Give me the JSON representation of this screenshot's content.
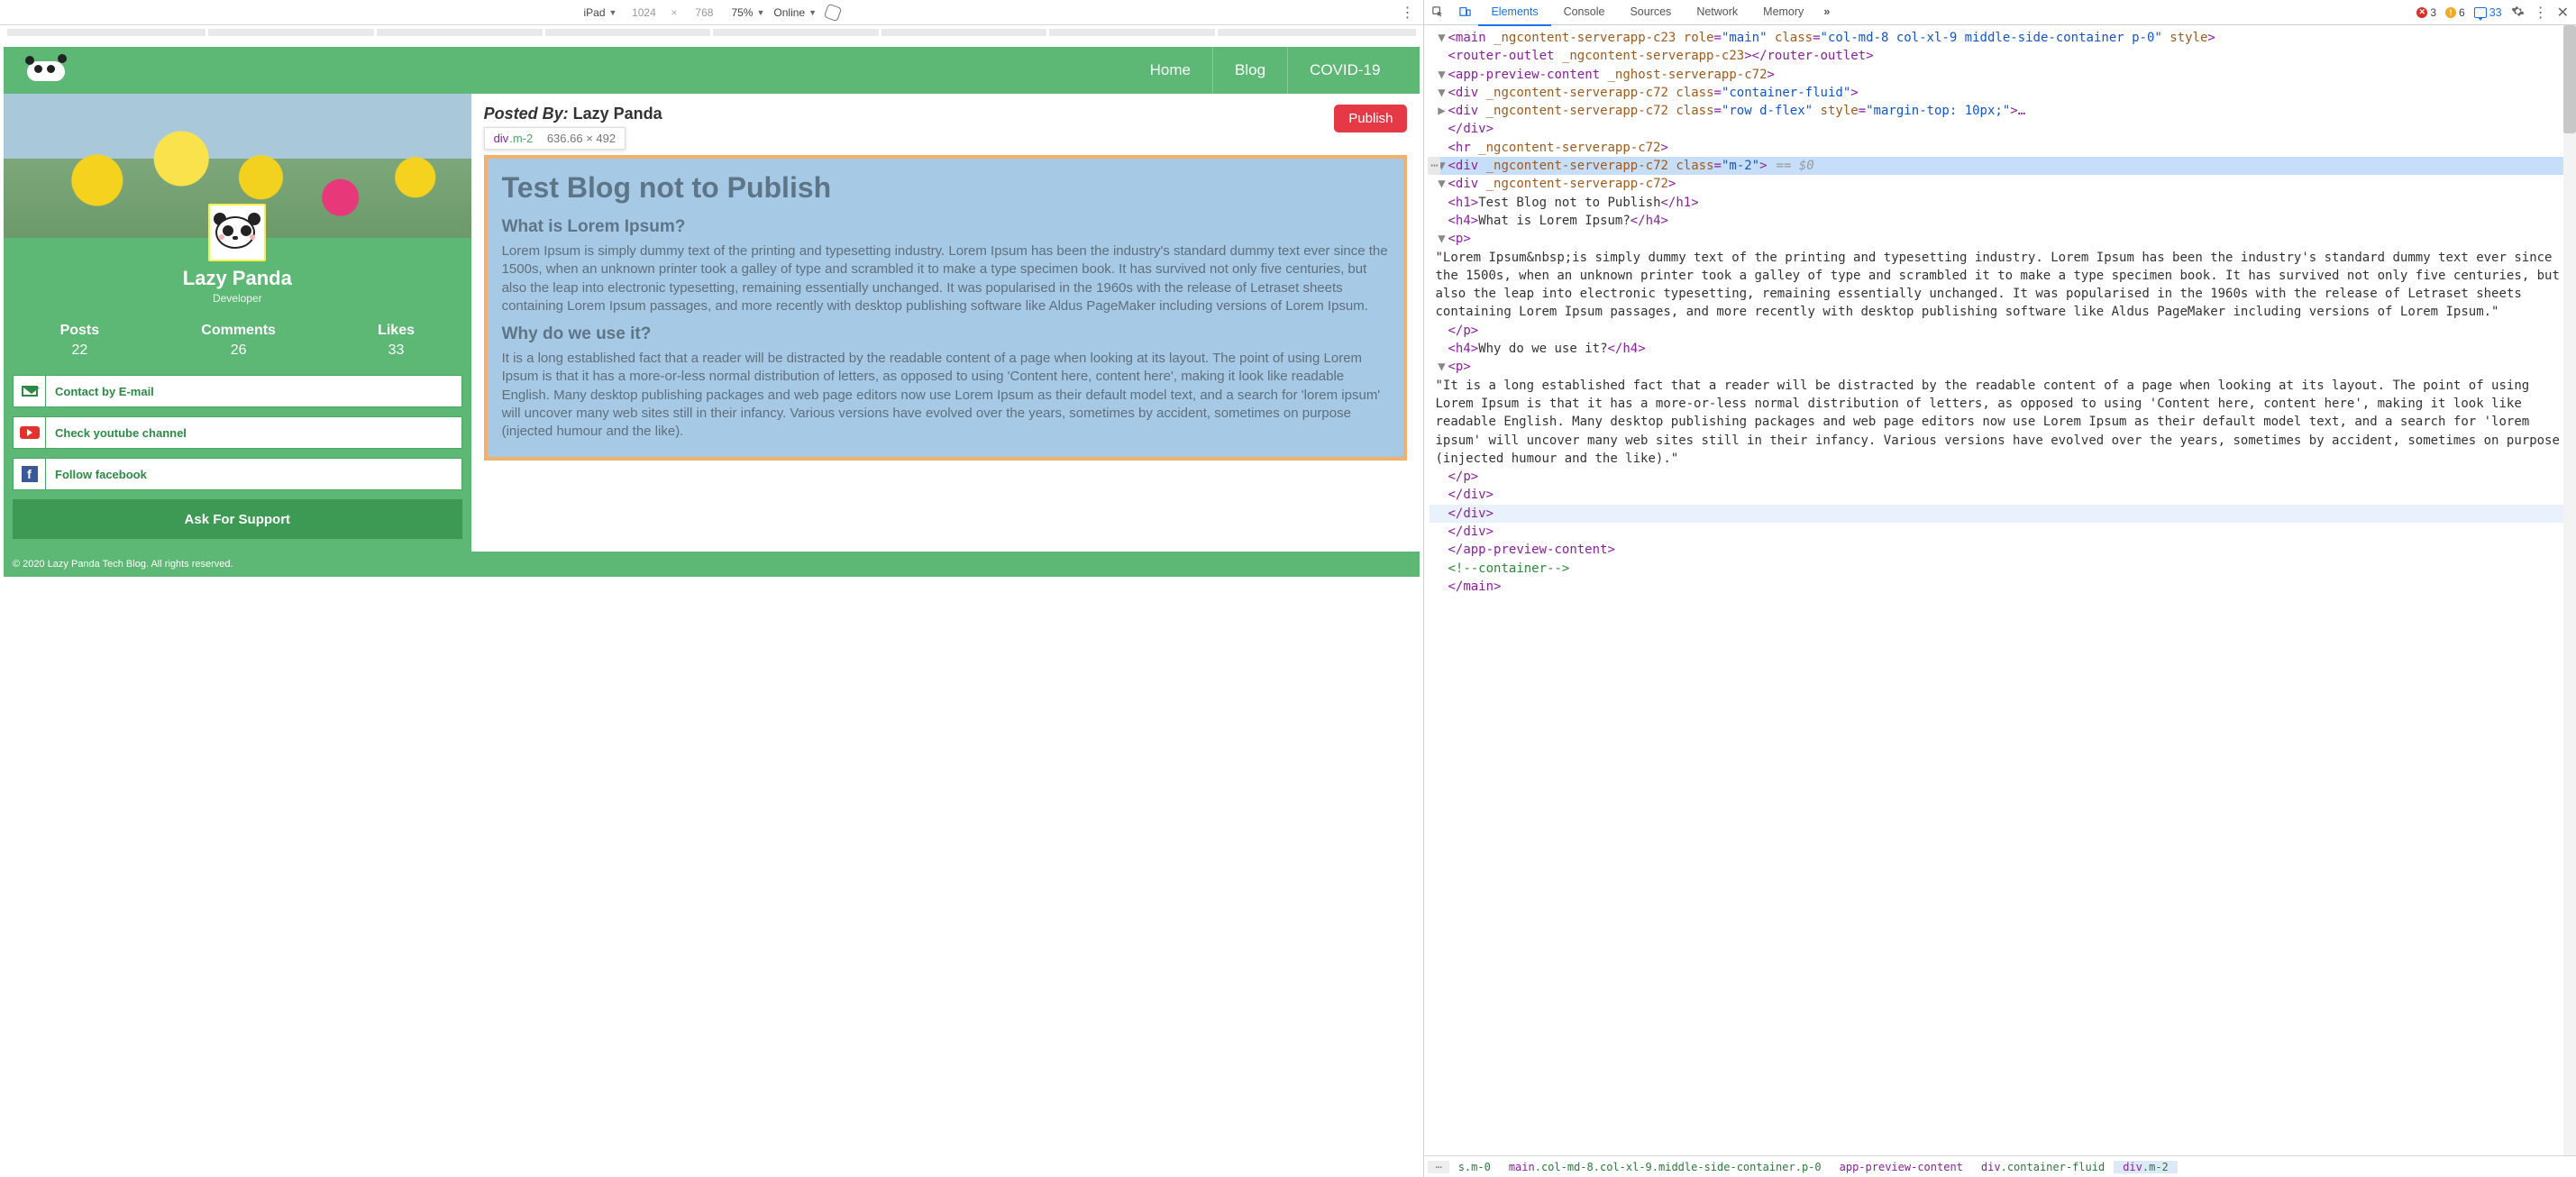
{
  "deviceToolbar": {
    "device": "iPad",
    "width": "1024",
    "height": "768",
    "zoom": "75%",
    "throttle": "Online"
  },
  "site": {
    "nav": {
      "home": "Home",
      "blog": "Blog",
      "covid": "COVID-19"
    },
    "profile": {
      "name": "Lazy Panda",
      "role": "Developer"
    },
    "stats": {
      "posts_lbl": "Posts",
      "posts": "22",
      "comments_lbl": "Comments",
      "comments": "26",
      "likes_lbl": "Likes",
      "likes": "33"
    },
    "side": {
      "email": "Contact by E-mail",
      "youtube": "Check youtube channel",
      "facebook": "Follow facebook",
      "ask": "Ask For Support"
    },
    "post": {
      "posted_by_lbl": "Posted By:",
      "author": "Lazy Panda",
      "tooltip_el": "div",
      "tooltip_cls": ".m-2",
      "tooltip_dims": "636.66 × 492",
      "publish": "Publish",
      "h1": "Test Blog not to Publish",
      "h4a": "What is Lorem Ipsum?",
      "p1": "Lorem Ipsum is simply dummy text of the printing and typesetting industry. Lorem Ipsum has been the industry's standard dummy text ever since the 1500s, when an unknown printer took a galley of type and scrambled it to make a type specimen book. It has survived not only five centuries, but also the leap into electronic typesetting, remaining essentially unchanged. It was popularised in the 1960s with the release of Letraset sheets containing Lorem Ipsum passages, and more recently with desktop publishing software like Aldus PageMaker including versions of Lorem Ipsum.",
      "h4b": "Why do we use it?",
      "p2": "It is a long established fact that a reader will be distracted by the readable content of a page when looking at its layout. The point of using Lorem Ipsum is that it has a more-or-less normal distribution of letters, as opposed to using 'Content here, content here', making it look like readable English. Many desktop publishing packages and web page editors now use Lorem Ipsum as their default model text, and a search for 'lorem ipsum' will uncover many web sites still in their infancy. Various versions have evolved over the years, sometimes by accident, sometimes on purpose (injected humour and the like)."
    },
    "footer": "© 2020 Lazy Panda Tech Blog. All rights reserved."
  },
  "devtools": {
    "tabs": {
      "elements": "Elements",
      "console": "Console",
      "sources": "Sources",
      "network": "Network",
      "memory": "Memory"
    },
    "status": {
      "errors": "3",
      "warnings": "6",
      "messages": "33"
    },
    "dom": {
      "l1": {
        "pre": "<",
        "tag": "main",
        "a1": " _ngcontent-serverapp-c23 ",
        "a2": "role",
        "v2": "\"main\"",
        "a3": " class",
        "v3": "\"col-md-8 col-xl-9 middle-side-container p-0\"",
        "a4": " style",
        "post": ">"
      },
      "l2": {
        "pre": "<",
        "tag": "router-outlet",
        "a1": " _ngcontent-serverapp-c23",
        "mid": ">",
        "close": "</router-outlet>"
      },
      "l3": {
        "pre": "<",
        "tag": "app-preview-content",
        "a1": " _nghost-serverapp-c72",
        "post": ">"
      },
      "l4": {
        "pre": "<",
        "tag": "div",
        "a1": " _ngcontent-serverapp-c72 ",
        "a2": "class",
        "v2": "\"container-fluid\"",
        "post": ">"
      },
      "l5": {
        "pre": "<",
        "tag": "div",
        "a1": " _ngcontent-serverapp-c72 ",
        "a2": "class",
        "v2": "\"row d-flex\"",
        "a3": " style",
        "v3": "\"margin-top: 10px;\"",
        "post": ">…"
      },
      "l5c": "</div>",
      "l6": {
        "pre": "<",
        "tag": "hr",
        "a1": " _ngcontent-serverapp-c72",
        "post": ">"
      },
      "l7": {
        "pre": "<",
        "tag": "div",
        "a1": " _ngcontent-serverapp-c72 ",
        "a2": "class",
        "v2": "\"m-2\"",
        "post": ">",
        "sel": "== $0"
      },
      "l8": {
        "pre": "<",
        "tag": "div",
        "a1": " _ngcontent-serverapp-c72",
        "post": ">"
      },
      "l9": {
        "pre": "<",
        "tag": "h1",
        "post": ">",
        "txt": "Test Blog not to Publish",
        "close": "</h1>"
      },
      "l10": {
        "pre": "<",
        "tag": "h4",
        "post": ">",
        "txt": "What is Lorem Ipsum?",
        "close": "</h4>"
      },
      "l11": {
        "pre": "<",
        "tag": "p",
        "post": ">"
      },
      "l12": "\"Lorem Ipsum&nbsp;is simply dummy text of the printing and typesetting industry. Lorem Ipsum has been the industry's standard dummy text ever since the 1500s, when an unknown printer took a galley of type and scrambled it to make a type specimen book. It has survived not only five centuries, but also the leap into electronic typesetting, remaining essentially unchanged. It was popularised in the 1960s with the release of Letraset sheets containing Lorem Ipsum passages, and more recently with desktop publishing software like Aldus PageMaker including versions of Lorem Ipsum.\"",
      "l12c": "</p>",
      "l13": {
        "pre": "<",
        "tag": "h4",
        "post": ">",
        "txt": "Why do we use it?",
        "close": "</h4>"
      },
      "l14": {
        "pre": "<",
        "tag": "p",
        "post": ">"
      },
      "l15": "\"It is a long established fact that a reader will be distracted by the readable content of a page when looking at its layout. The point of using Lorem Ipsum is that it has a more-or-less normal distribution of letters, as opposed to using 'Content here, content here', making it look like readable English. Many desktop publishing packages and web page editors now use Lorem Ipsum as their default model text, and a search for 'lorem ipsum' will uncover many web sites still in their infancy. Various versions have evolved over the years, sometimes by accident, sometimes on purpose (injected humour and the like).\"",
      "l15c": "</p>",
      "l16": "</div>",
      "l17": "</div>",
      "l18": "</div>",
      "l19": "</app-preview-content>",
      "l20": "<!--container-->",
      "l21": "</main>"
    },
    "crumbs": {
      "c1": "s.m-0",
      "c2_el": "main",
      "c2_cls": ".col-md-8.col-xl-9.middle-side-container.p-0",
      "c3": "app-preview-content",
      "c4_el": "div",
      "c4_cls": ".container-fluid",
      "c5_el": "div",
      "c5_cls": ".m-2"
    }
  }
}
